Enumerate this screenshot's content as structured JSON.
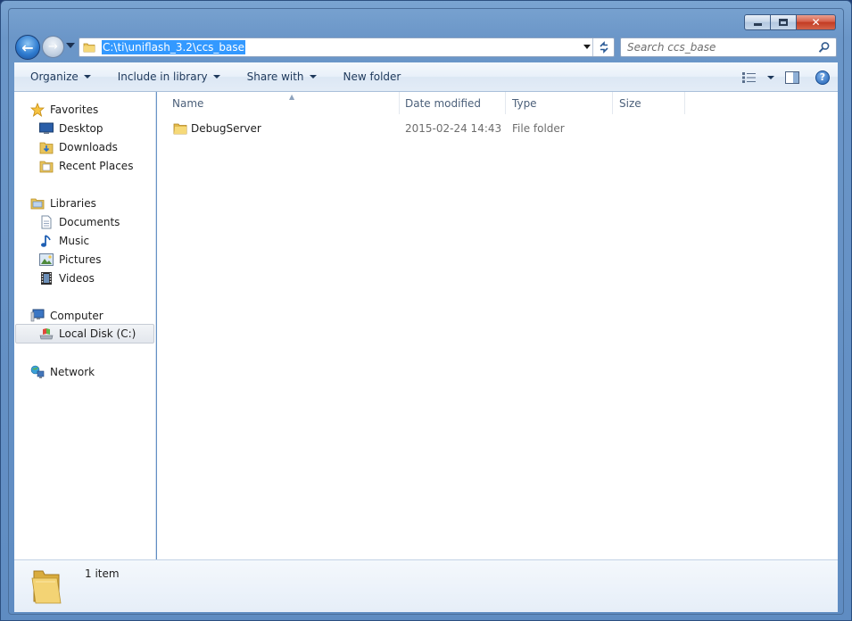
{
  "window": {
    "caption_buttons": [
      "minimize",
      "maximize",
      "close"
    ]
  },
  "address_bar": {
    "path": "C:\\ti\\uniflash_3.2\\ccs_base"
  },
  "search": {
    "placeholder": "Search ccs_base"
  },
  "toolbar": {
    "organize": "Organize",
    "include_in_library": "Include in library",
    "share_with": "Share with",
    "new_folder": "New folder"
  },
  "sidebar": {
    "favorites": {
      "label": "Favorites",
      "items": [
        {
          "label": "Desktop",
          "icon": "desktop-icon"
        },
        {
          "label": "Downloads",
          "icon": "downloads-icon"
        },
        {
          "label": "Recent Places",
          "icon": "recent-places-icon"
        }
      ]
    },
    "libraries": {
      "label": "Libraries",
      "items": [
        {
          "label": "Documents",
          "icon": "documents-icon"
        },
        {
          "label": "Music",
          "icon": "music-icon"
        },
        {
          "label": "Pictures",
          "icon": "pictures-icon"
        },
        {
          "label": "Videos",
          "icon": "videos-icon"
        }
      ]
    },
    "computer": {
      "label": "Computer",
      "items": [
        {
          "label": "Local Disk (C:)",
          "icon": "local-disk-icon",
          "selected": true
        }
      ]
    },
    "network": {
      "label": "Network"
    }
  },
  "columns": {
    "name": "Name",
    "date_modified": "Date modified",
    "type": "Type",
    "size": "Size"
  },
  "files": [
    {
      "name": "DebugServer",
      "date_modified": "2015-02-24 14:43",
      "type": "File folder",
      "size": ""
    }
  ],
  "details": {
    "count": "1 item"
  },
  "colors": {
    "selection": "#3399ff",
    "frame": "#6b96c8",
    "toolbar_text": "#1e395b",
    "column_header_text": "#4c607a",
    "secondary_text": "#6d6d6d"
  }
}
